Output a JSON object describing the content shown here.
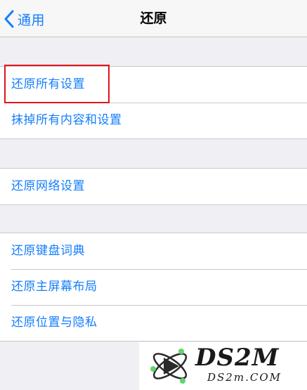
{
  "nav": {
    "back_label": "通用",
    "title": "还原"
  },
  "groups": [
    {
      "items": [
        {
          "label": "还原所有设置"
        },
        {
          "label": "抹掉所有内容和设置"
        }
      ]
    },
    {
      "items": [
        {
          "label": "还原网络设置"
        }
      ]
    },
    {
      "items": [
        {
          "label": "还原键盘词典"
        },
        {
          "label": "还原主屏幕布局"
        },
        {
          "label": "还原位置与隐私"
        }
      ]
    }
  ],
  "colors": {
    "accent": "#147efb",
    "highlight": "#e0151c",
    "background": "#efeff4"
  },
  "watermark": {
    "main": "DS2M",
    "sub": "DS2m.COM"
  }
}
